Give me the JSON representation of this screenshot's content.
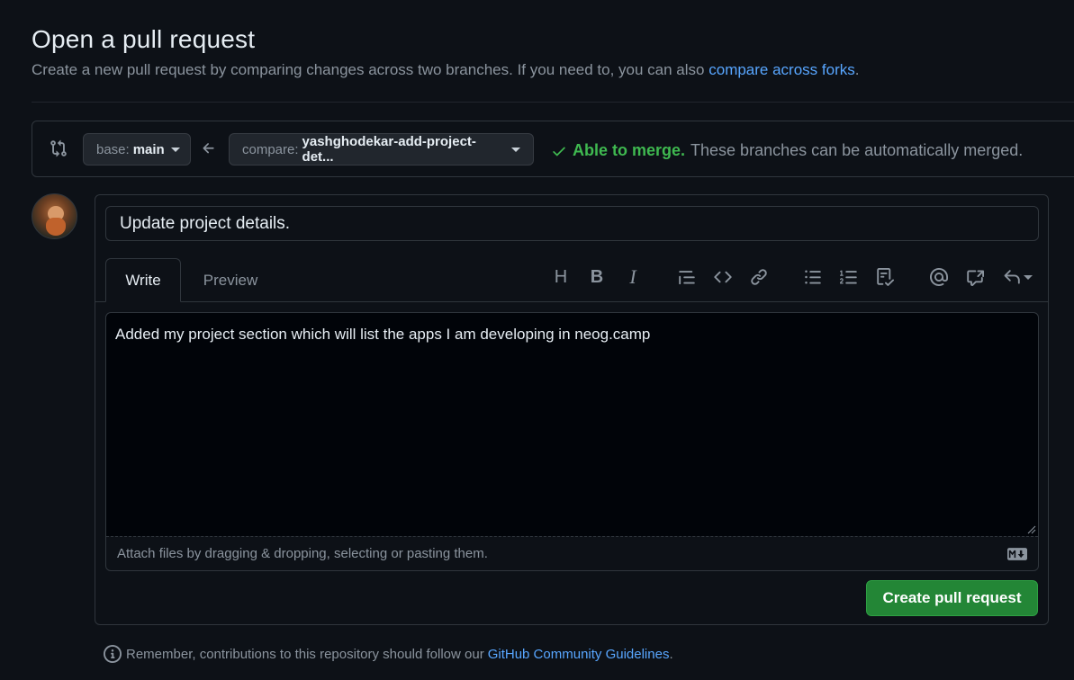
{
  "header": {
    "title": "Open a pull request",
    "subtitle": "Create a new pull request by comparing changes across two branches. If you need to, you can also",
    "compare_forks_link": "compare across forks",
    "subtitle_end": "."
  },
  "branches": {
    "base_key": "base:",
    "base_value": "main",
    "compare_key": "compare:",
    "compare_value": "yashghodekar-add-project-det..."
  },
  "merge": {
    "status": "Able to merge.",
    "description": "These branches can be automatically merged."
  },
  "editor": {
    "title_value": "Update project details.",
    "tab_write": "Write",
    "tab_preview": "Preview",
    "body_value": "Added my project section which will list the apps I am developing in neog.camp",
    "attach_hint": "Attach files by dragging & dropping, selecting or pasting them.",
    "toolbar": {
      "heading": "H",
      "bold": "B",
      "italic": "I"
    }
  },
  "actions": {
    "create_button": "Create pull request"
  },
  "footer": {
    "note": "Remember, contributions to this repository should follow our",
    "guidelines_link": "GitHub Community Guidelines",
    "note_end": "."
  },
  "colors": {
    "background": "#0d1117",
    "success": "#3fb950",
    "link": "#58a6ff",
    "primary_button": "#238636"
  }
}
